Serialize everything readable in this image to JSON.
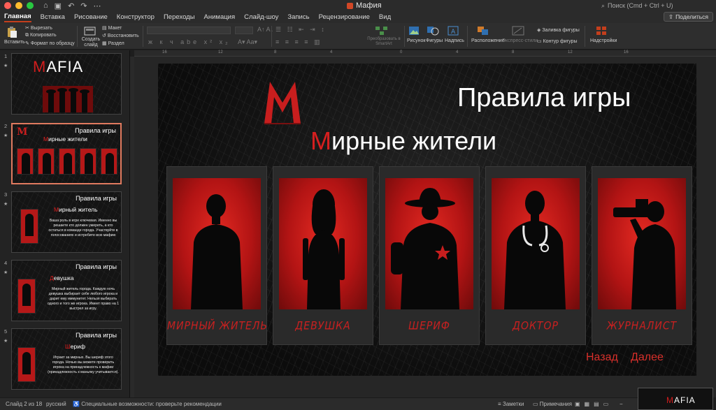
{
  "window": {
    "title": "Мафия",
    "search_placeholder": "Поиск (Cmd + Ctrl + U)"
  },
  "tabs": [
    "Главная",
    "Вставка",
    "Рисование",
    "Конструктор",
    "Переходы",
    "Анимация",
    "Слайд-шоу",
    "Запись",
    "Рецензирование",
    "Вид"
  ],
  "share_label": "Поделиться",
  "ribbon": {
    "paste": "Вставить",
    "cut": "Вырезать",
    "copy": "Копировать",
    "format_painter": "Формат по образцу",
    "new_slide": "Создать слайд",
    "layout": "Макет",
    "reset": "Восстановить",
    "section": "Раздел",
    "convert_smartart": "Преобразовать в SmartArt",
    "picture": "Рисунок",
    "shapes": "Фигуры",
    "textbox": "Надпись",
    "arrange": "Расположение",
    "quick_styles": "Экспресс-стили",
    "shape_fill": "Заливка фигуры",
    "shape_outline": "Контур фигуры",
    "addins": "Надстройки"
  },
  "thumbnails": [
    {
      "num": "1",
      "mafia_m": "M",
      "mafia_rest": "AFIA"
    },
    {
      "num": "2",
      "title": "Правила игры",
      "sub_m": "М",
      "sub_rest": "ирные жители"
    },
    {
      "num": "3",
      "title": "Правила игры",
      "sub_m": "М",
      "sub_rest": "ирный житель",
      "text": "Ваша роль в игре ключевая. Именно вы решаете кто должен умереть, а кто остаться в команде города. Участвуйте в голосованиях и истребите всю мафию"
    },
    {
      "num": "4",
      "title": "Правила игры",
      "sub_m": "Д",
      "sub_rest": "евушка",
      "text": "Мирный житель города. Каждую ночь девушка выбирает себе любого игрока и дарит ему иммунитет. Нельзя выбирать одного и того же игрока. Имеет право на 1 выстрел за игру."
    },
    {
      "num": "5",
      "title": "Правила игры",
      "sub_m": "Ш",
      "sub_rest": "ериф",
      "text": "Играет за мирных. Вы шериф этого города. Ночью вы можете проверить игрока на принадлежность к мафии (принадлежность к маньяку учитывается)."
    }
  ],
  "slide": {
    "logo_letter": "M",
    "title": "Правила игры",
    "subtitle_first": "М",
    "subtitle_rest": "ирные жители",
    "cards": [
      {
        "caption": "МИРНЫЙ ЖИТЕЛЬ",
        "figure": "man-silhouette"
      },
      {
        "caption": "ДЕВУШКА",
        "figure": "woman-silhouette"
      },
      {
        "caption": "ШЕРИФ",
        "figure": "sheriff-silhouette"
      },
      {
        "caption": "ДОКТОР",
        "figure": "doctor-silhouette"
      },
      {
        "caption": "ЖУРНАЛИСТ",
        "figure": "photographer-silhouette"
      }
    ],
    "back": "Назад",
    "next": "Далее"
  },
  "status": {
    "slide_info": "Слайд 2 из 18",
    "language": "русский",
    "accessibility": "Специальные возможности: проверьте рекомендации",
    "notes": "Заметки",
    "comments": "Примечания"
  },
  "colors": {
    "accent": "#c43e1c",
    "slide_red": "#d61f1f"
  }
}
